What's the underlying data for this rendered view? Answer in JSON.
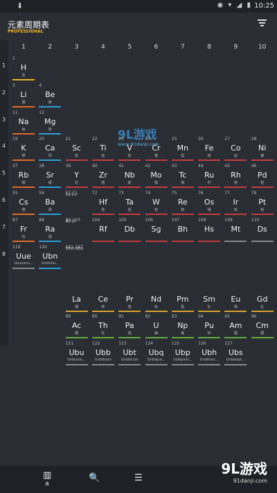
{
  "status": {
    "download_icon": "download-icon",
    "time": "10:25",
    "icons": "◉ ▾ ◢ ▮"
  },
  "app": {
    "title": "元素周期表",
    "subtitle": "PROFESSIONAL",
    "filter_icon": "filter-icon"
  },
  "group_numbers": [
    "1",
    "2",
    "3",
    "4",
    "5",
    "6",
    "7",
    "8",
    "9",
    "10"
  ],
  "period_numbers": [
    "1",
    "2",
    "3",
    "4",
    "5",
    "6",
    "7",
    "8"
  ],
  "colors": {
    "alkali": "#e06b2c",
    "alkaline": "#2c9fd6",
    "hydrogen": "#e0b42c",
    "transition": "#c43c3c",
    "lanthanide": "#d8a52c",
    "actinide": "#5fae3f",
    "unknown": "#8a8a8a",
    "metalloid": "#4fb3a5"
  },
  "elements": [
    {
      "n": "1",
      "s": "H",
      "c": "氢",
      "g": 0,
      "p": 0,
      "cat": "hydrogen"
    },
    {
      "n": "3",
      "s": "Li",
      "c": "锂",
      "g": 0,
      "p": 1,
      "cat": "alkali"
    },
    {
      "n": "4",
      "s": "Be",
      "c": "铍",
      "g": 1,
      "p": 1,
      "cat": "alkaline"
    },
    {
      "n": "11",
      "s": "Na",
      "c": "钠",
      "g": 0,
      "p": 2,
      "cat": "alkali"
    },
    {
      "n": "12",
      "s": "Mg",
      "c": "镁",
      "g": 1,
      "p": 2,
      "cat": "alkaline"
    },
    {
      "n": "19",
      "s": "K",
      "c": "钾",
      "g": 0,
      "p": 3,
      "cat": "alkali"
    },
    {
      "n": "20",
      "s": "Ca",
      "c": "钙",
      "g": 1,
      "p": 3,
      "cat": "alkaline"
    },
    {
      "n": "21",
      "s": "Sc",
      "c": "钪",
      "g": 2,
      "p": 3,
      "cat": "transition"
    },
    {
      "n": "22",
      "s": "Ti",
      "c": "钛",
      "g": 3,
      "p": 3,
      "cat": "transition"
    },
    {
      "n": "23",
      "s": "V",
      "c": "钒",
      "g": 4,
      "p": 3,
      "cat": "transition"
    },
    {
      "n": "24",
      "s": "Cr",
      "c": "铬",
      "g": 5,
      "p": 3,
      "cat": "transition"
    },
    {
      "n": "25",
      "s": "Mn",
      "c": "锰",
      "g": 6,
      "p": 3,
      "cat": "transition"
    },
    {
      "n": "26",
      "s": "Fe",
      "c": "铁",
      "g": 7,
      "p": 3,
      "cat": "transition"
    },
    {
      "n": "27",
      "s": "Co",
      "c": "钴",
      "g": 8,
      "p": 3,
      "cat": "transition"
    },
    {
      "n": "28",
      "s": "Ni",
      "c": "镍",
      "g": 9,
      "p": 3,
      "cat": "transition"
    },
    {
      "n": "37",
      "s": "Rb",
      "c": "铷",
      "g": 0,
      "p": 4,
      "cat": "alkali"
    },
    {
      "n": "38",
      "s": "Sr",
      "c": "锶",
      "g": 1,
      "p": 4,
      "cat": "alkaline"
    },
    {
      "n": "39",
      "s": "Y",
      "c": "钇",
      "g": 2,
      "p": 4,
      "cat": "transition"
    },
    {
      "n": "40",
      "s": "Zr",
      "c": "锆",
      "g": 3,
      "p": 4,
      "cat": "transition"
    },
    {
      "n": "41",
      "s": "Nb",
      "c": "铌",
      "g": 4,
      "p": 4,
      "cat": "transition"
    },
    {
      "n": "42",
      "s": "Mo",
      "c": "钼",
      "g": 5,
      "p": 4,
      "cat": "transition"
    },
    {
      "n": "43",
      "s": "Tc",
      "c": "锝",
      "g": 6,
      "p": 4,
      "cat": "transition"
    },
    {
      "n": "44",
      "s": "Ru",
      "c": "钌",
      "g": 7,
      "p": 4,
      "cat": "transition"
    },
    {
      "n": "45",
      "s": "Rh",
      "c": "铑",
      "g": 8,
      "p": 4,
      "cat": "transition"
    },
    {
      "n": "46",
      "s": "Pd",
      "c": "钯",
      "g": 9,
      "p": 4,
      "cat": "transition"
    },
    {
      "n": "55",
      "s": "Cs",
      "c": "铯",
      "g": 0,
      "p": 5,
      "cat": "alkali"
    },
    {
      "n": "56",
      "s": "Ba",
      "c": "钡",
      "g": 1,
      "p": 5,
      "cat": "alkaline"
    },
    {
      "n": "57-71",
      "s": "La-Lu",
      "c": "",
      "g": 2,
      "p": 5,
      "cat": "text"
    },
    {
      "n": "72",
      "s": "Hf",
      "c": "铪",
      "g": 3,
      "p": 5,
      "cat": "transition"
    },
    {
      "n": "73",
      "s": "Ta",
      "c": "钽",
      "g": 4,
      "p": 5,
      "cat": "transition"
    },
    {
      "n": "74",
      "s": "W",
      "c": "钨",
      "g": 5,
      "p": 5,
      "cat": "transition"
    },
    {
      "n": "75",
      "s": "Re",
      "c": "铼",
      "g": 6,
      "p": 5,
      "cat": "transition"
    },
    {
      "n": "76",
      "s": "Os",
      "c": "锇",
      "g": 7,
      "p": 5,
      "cat": "transition"
    },
    {
      "n": "77",
      "s": "Ir",
      "c": "铱",
      "g": 8,
      "p": 5,
      "cat": "transition"
    },
    {
      "n": "78",
      "s": "Pt",
      "c": "铂",
      "g": 9,
      "p": 5,
      "cat": "transition"
    },
    {
      "n": "87",
      "s": "Fr",
      "c": "钫",
      "g": 0,
      "p": 6,
      "cat": "alkali"
    },
    {
      "n": "88",
      "s": "Ra",
      "c": "镭",
      "g": 1,
      "p": 6,
      "cat": "alkaline"
    },
    {
      "n": "89-103",
      "s": "Ac-Lr",
      "c": "",
      "g": 2,
      "p": 6,
      "cat": "text"
    },
    {
      "n": "104",
      "s": "Rf",
      "c": "",
      "g": 3,
      "p": 6,
      "cat": "transition"
    },
    {
      "n": "105",
      "s": "Db",
      "c": "",
      "g": 4,
      "p": 6,
      "cat": "transition"
    },
    {
      "n": "106",
      "s": "Sg",
      "c": "",
      "g": 5,
      "p": 6,
      "cat": "transition"
    },
    {
      "n": "107",
      "s": "Bh",
      "c": "",
      "g": 6,
      "p": 6,
      "cat": "transition"
    },
    {
      "n": "108",
      "s": "Hs",
      "c": "",
      "g": 7,
      "p": 6,
      "cat": "transition"
    },
    {
      "n": "109",
      "s": "Mt",
      "c": "",
      "g": 8,
      "p": 6,
      "cat": "unknown"
    },
    {
      "n": "110",
      "s": "Ds",
      "c": "",
      "g": 9,
      "p": 6,
      "cat": "unknown"
    },
    {
      "n": "119",
      "s": "Uue",
      "c": "Ununenn...",
      "g": 0,
      "p": 7,
      "cat": "unknown"
    },
    {
      "n": "120",
      "s": "Ubn",
      "c": "Unbinilu...",
      "g": 1,
      "p": 7,
      "cat": "alkaline"
    },
    {
      "n": "121-127",
      "s": "Ubu-Ubs",
      "c": "",
      "g": 2,
      "p": 7,
      "cat": "text"
    },
    {
      "n": "",
      "s": "La",
      "c": "镧",
      "g": 2,
      "p": 8.6,
      "cat": "lanthanide"
    },
    {
      "n": "",
      "s": "Ce",
      "c": "铈",
      "g": 3,
      "p": 8.6,
      "cat": "lanthanide"
    },
    {
      "n": "",
      "s": "Pr",
      "c": "镨",
      "g": 4,
      "p": 8.6,
      "cat": "lanthanide"
    },
    {
      "n": "",
      "s": "Nd",
      "c": "钕",
      "g": 5,
      "p": 8.6,
      "cat": "lanthanide"
    },
    {
      "n": "",
      "s": "Pm",
      "c": "钷",
      "g": 6,
      "p": 8.6,
      "cat": "lanthanide"
    },
    {
      "n": "",
      "s": "Sm",
      "c": "钐",
      "g": 7,
      "p": 8.6,
      "cat": "lanthanide"
    },
    {
      "n": "",
      "s": "Eu",
      "c": "铕",
      "g": 8,
      "p": 8.6,
      "cat": "lanthanide"
    },
    {
      "n": "",
      "s": "Gd",
      "c": "钆",
      "g": 9,
      "p": 8.6,
      "cat": "lanthanide"
    },
    {
      "n": "89",
      "s": "Ac",
      "c": "锕",
      "g": 2,
      "p": 9.6,
      "cat": "actinide"
    },
    {
      "n": "90",
      "s": "Th",
      "c": "钍",
      "g": 3,
      "p": 9.6,
      "cat": "actinide"
    },
    {
      "n": "91",
      "s": "Pa",
      "c": "镤",
      "g": 4,
      "p": 9.6,
      "cat": "actinide"
    },
    {
      "n": "92",
      "s": "U",
      "c": "铀",
      "g": 5,
      "p": 9.6,
      "cat": "actinide"
    },
    {
      "n": "93",
      "s": "Np",
      "c": "镎",
      "g": 6,
      "p": 9.6,
      "cat": "actinide"
    },
    {
      "n": "94",
      "s": "Pu",
      "c": "钚",
      "g": 7,
      "p": 9.6,
      "cat": "actinide"
    },
    {
      "n": "95",
      "s": "Am",
      "c": "镅",
      "g": 8,
      "p": 9.6,
      "cat": "actinide"
    },
    {
      "n": "96",
      "s": "Cm",
      "c": "锔",
      "g": 9,
      "p": 9.6,
      "cat": "actinide"
    },
    {
      "n": "121",
      "s": "Ubu",
      "c": "Unbiuniu...",
      "g": 2,
      "p": 10.6,
      "cat": "unknown"
    },
    {
      "n": "122",
      "s": "Ubb",
      "c": "Unbibium",
      "g": 3,
      "p": 10.6,
      "cat": "unknown"
    },
    {
      "n": "123",
      "s": "Ubt",
      "c": "Unbitrium",
      "g": 4,
      "p": 10.6,
      "cat": "unknown"
    },
    {
      "n": "124",
      "s": "Ubq",
      "c": "Unbiqua...",
      "g": 5,
      "p": 10.6,
      "cat": "unknown"
    },
    {
      "n": "125",
      "s": "Ubp",
      "c": "Unbipent...",
      "g": 6,
      "p": 10.6,
      "cat": "unknown"
    },
    {
      "n": "126",
      "s": "Ubh",
      "c": "Unbihexi...",
      "g": 7,
      "p": 10.6,
      "cat": "unknown"
    },
    {
      "n": "127",
      "s": "Ubs",
      "c": "Unbisept...",
      "g": 8,
      "p": 10.6,
      "cat": "unknown"
    }
  ],
  "watermark": {
    "text": "9L游戏",
    "url": "www.91danji.com"
  },
  "bottom_nav": [
    {
      "icon": "table-icon",
      "label": "表"
    },
    {
      "icon": "search-icon",
      "label": ""
    },
    {
      "icon": "list-icon",
      "label": ""
    }
  ],
  "brand": {
    "text": "9L游戏",
    "url": "91danji.com"
  }
}
